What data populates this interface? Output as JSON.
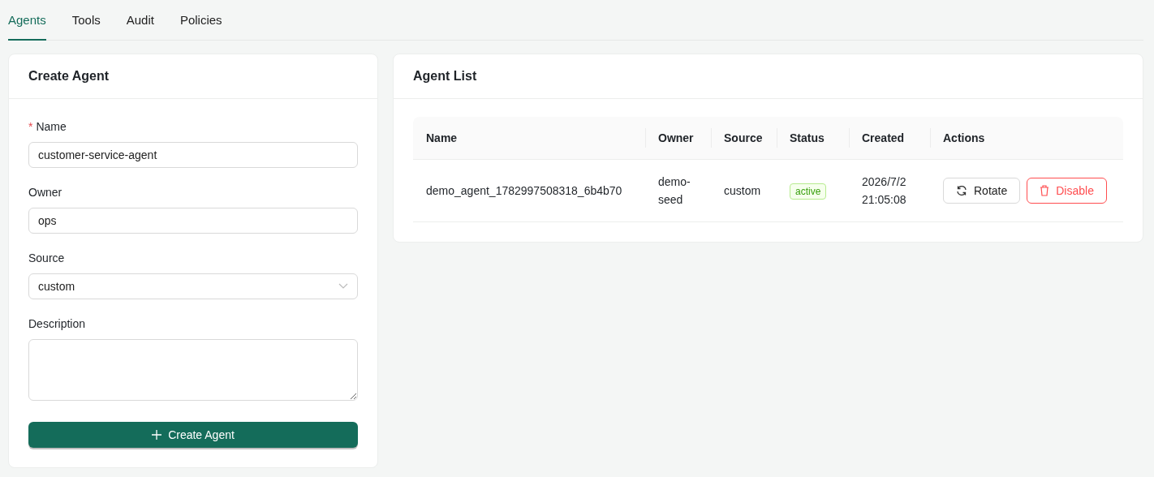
{
  "tabs": [
    {
      "label": "Agents",
      "selected": true
    },
    {
      "label": "Tools",
      "selected": false
    },
    {
      "label": "Audit",
      "selected": false
    },
    {
      "label": "Policies",
      "selected": false
    }
  ],
  "create_agent": {
    "title": "Create Agent",
    "fields": [
      {
        "kind": "input",
        "label": "Name",
        "required_mark": "*",
        "value": "customer-service-agent"
      },
      {
        "kind": "input",
        "label": "Owner",
        "value": "ops"
      },
      {
        "kind": "select",
        "label": "Source",
        "value": "custom"
      },
      {
        "kind": "textarea",
        "label": "Description"
      }
    ],
    "submit": "Create Agent"
  },
  "agent_list": {
    "title": "Agent List",
    "columns": [
      "Name",
      "Owner",
      "Source",
      "Status",
      "Created",
      "Actions"
    ],
    "rows": [
      {
        "name": "demo_agent_1782997508318_6b4b70",
        "owner": "demo-seed",
        "source": "custom",
        "status": {
          "label": "active",
          "kind": "active"
        },
        "created": "2026/7/2 21:05:08",
        "actions": [
          {
            "label": "Rotate",
            "kind": "rotate"
          },
          {
            "label": "Disable",
            "kind": "disable"
          }
        ]
      }
    ]
  }
}
